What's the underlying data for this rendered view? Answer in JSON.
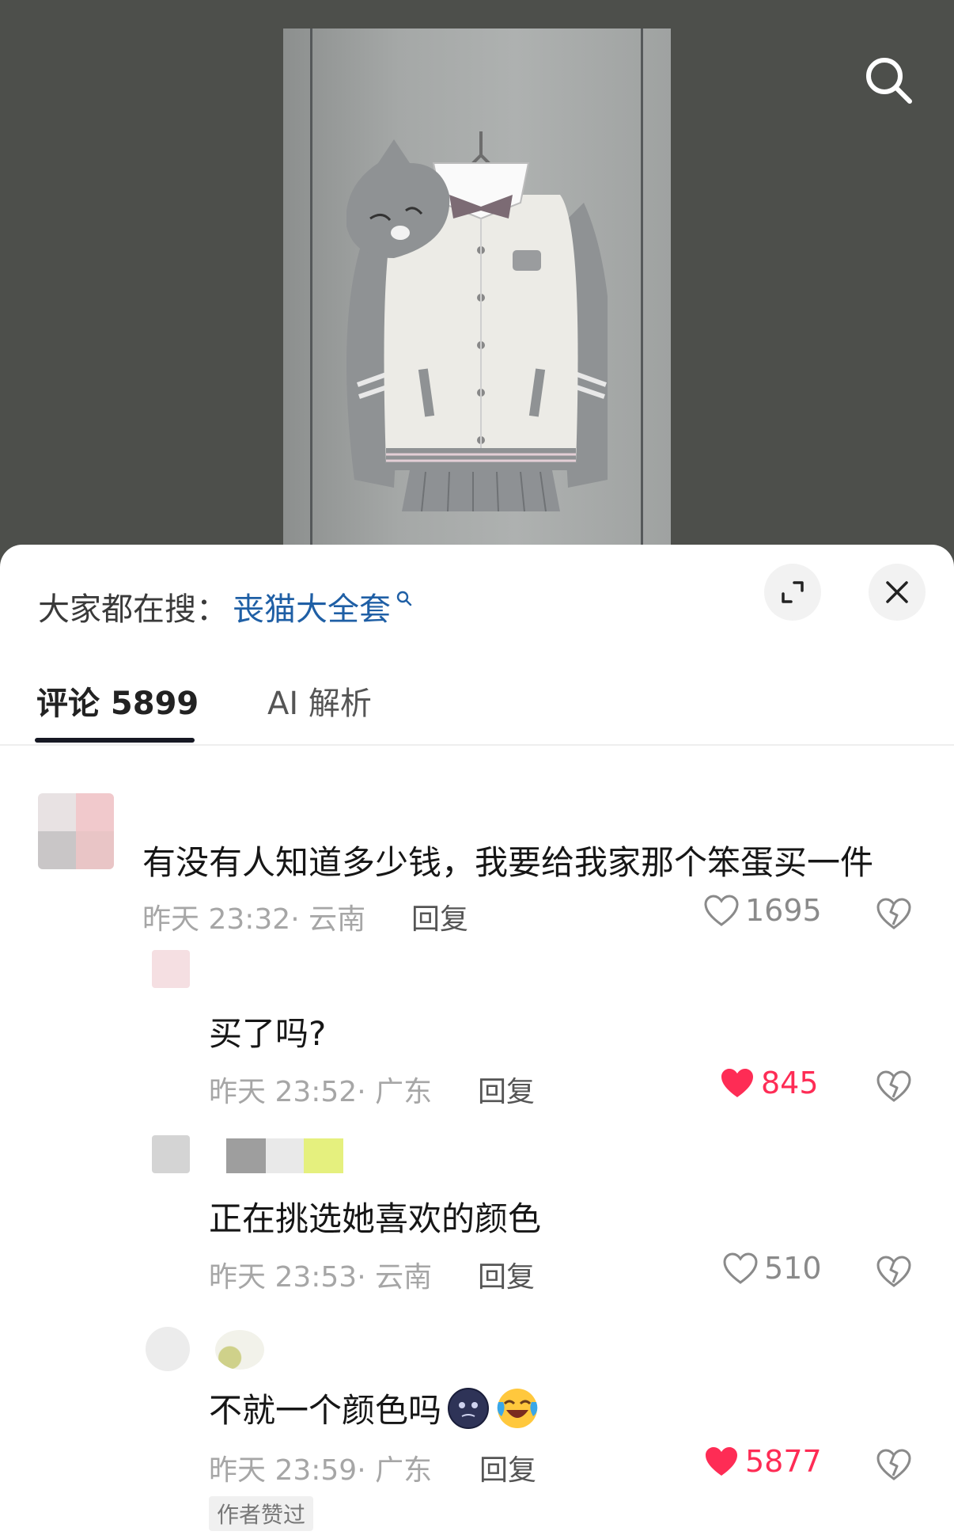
{
  "header": {
    "search_icon": "search-icon"
  },
  "sheet": {
    "search_prefix": "大家都在搜：",
    "search_term": "丧猫大全套",
    "expand_icon": "expand-icon",
    "close_icon": "close-icon"
  },
  "tabs": [
    {
      "label": "评论 5899",
      "active": true
    },
    {
      "label": "AI 解析",
      "active": false
    }
  ],
  "comments": [
    {
      "text": "有没有人知道多少钱，我要给我家那个笨蛋买一件",
      "time_loc": "昨天 23:32· 云南",
      "reply": "回复",
      "likes": "1695",
      "liked": false
    },
    {
      "text": "买了吗?",
      "time_loc": "昨天 23:52· 广东",
      "reply": "回复",
      "likes": "845",
      "liked": true
    },
    {
      "text": "正在挑选她喜欢的颜色",
      "time_loc": "昨天 23:53· 云南",
      "reply": "回复",
      "likes": "510",
      "liked": false
    },
    {
      "text": "不就一个颜色吗",
      "time_loc": "昨天 23:59· 广东",
      "reply": "回复",
      "likes": "5877",
      "liked": true,
      "badge": "作者赞过",
      "emojis": [
        "moon-face-emoji",
        "crying-laughing-emoji"
      ]
    }
  ],
  "colors": {
    "accent": "#fe2c55",
    "link": "#1f5fa5",
    "media_bg": "#4d4f4b"
  }
}
